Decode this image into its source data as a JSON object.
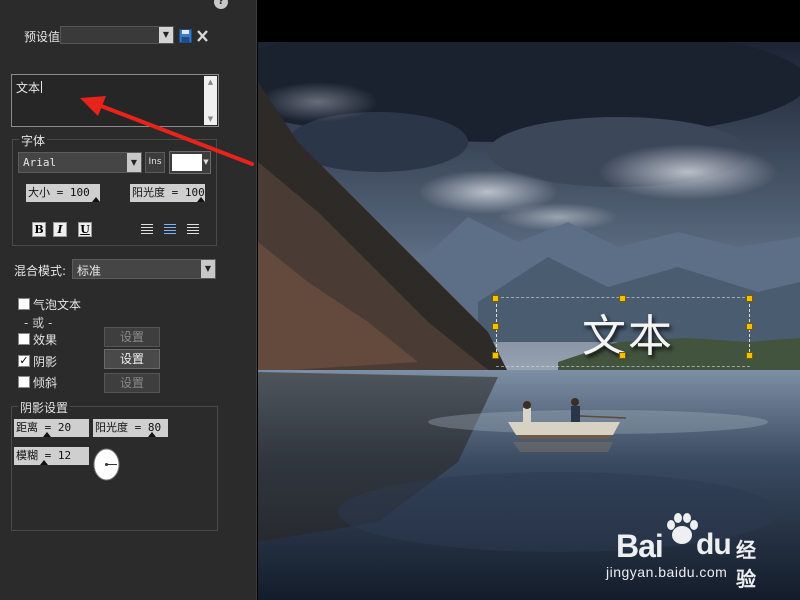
{
  "panel": {
    "help_icon": "question-mark-icon",
    "preset": {
      "label": "预设值",
      "value": ""
    },
    "text_input": {
      "value": "文本"
    },
    "font_group": {
      "legend": "字体",
      "font_name": "Arial",
      "ins_label": "Ins",
      "color": "#ffffff",
      "size_label": "大小 = 100",
      "opacity_label": "阳光度 = 100",
      "size_value": 100,
      "opacity_value": 100,
      "bold_label": "B",
      "italic_label": "I",
      "underline_label": "U"
    },
    "blend": {
      "label": "混合模式:",
      "value": "标准"
    },
    "options": {
      "bubble_text": "气泡文本",
      "or_label": "- 或 -",
      "effect": "效果",
      "shadow": "阴影",
      "bevel": "倾斜",
      "settings": "设置",
      "shadow_checked": true
    },
    "shadow_group": {
      "legend": "阴影设置",
      "distance_label": "距离 = 20",
      "opacity_label": "阳光度 = 80",
      "blur_label": "模糊 = 12",
      "distance_value": 20,
      "opacity_value": 80,
      "blur_value": 12
    }
  },
  "viewport": {
    "overlay_text": "文本",
    "watermark": {
      "brand": "Bai",
      "brand_cn": "经验",
      "url": "jingyan.baidu.com"
    }
  },
  "colors": {
    "panel_bg": "#2b2b2b",
    "handle": "#f2c200",
    "arrow": "#e8231b"
  }
}
